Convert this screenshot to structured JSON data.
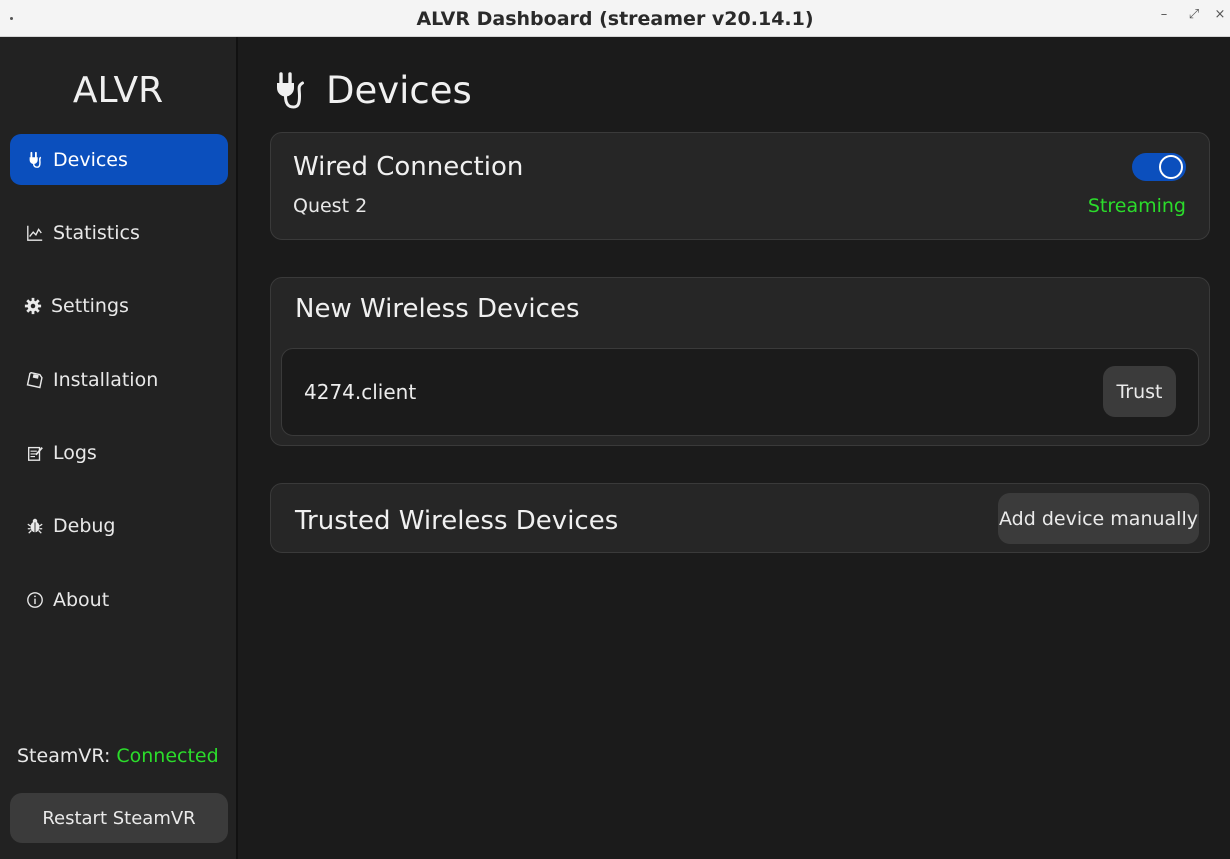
{
  "window": {
    "title": "ALVR Dashboard (streamer v20.14.1)",
    "controls": {
      "minimize": "–",
      "maximize": "⤢",
      "close": "×"
    }
  },
  "sidebar": {
    "brand": "ALVR",
    "items": [
      {
        "label": "Devices",
        "icon": "plug-icon",
        "active": true
      },
      {
        "label": "Statistics",
        "icon": "line-chart-icon",
        "active": false
      },
      {
        "label": "Settings",
        "icon": "gear-icon",
        "active": false
      },
      {
        "label": "Installation",
        "icon": "floppy-disk-icon",
        "active": false
      },
      {
        "label": "Logs",
        "icon": "notepad-icon",
        "active": false
      },
      {
        "label": "Debug",
        "icon": "bug-icon",
        "active": false
      },
      {
        "label": "About",
        "icon": "info-icon",
        "active": false
      }
    ],
    "steamvr_label": "SteamVR:",
    "steamvr_status": "Connected",
    "restart_label": "Restart SteamVR"
  },
  "main": {
    "title": "Devices",
    "title_icon": "plug-icon",
    "wired": {
      "title": "Wired Connection",
      "device": "Quest 2",
      "status": "Streaming",
      "toggle_on": true
    },
    "new_wireless": {
      "title": "New Wireless Devices",
      "devices": [
        {
          "name": "4274.client",
          "action": "Trust"
        }
      ]
    },
    "trusted_wireless": {
      "title": "Trusted Wireless Devices",
      "add_label": "Add device manually"
    }
  },
  "colors": {
    "accent": "#0b4fbd",
    "success": "#2bdc2b",
    "background": "#1b1b1b",
    "sidebar": "#222222",
    "panel": "#262626",
    "button": "#3b3b3b"
  }
}
